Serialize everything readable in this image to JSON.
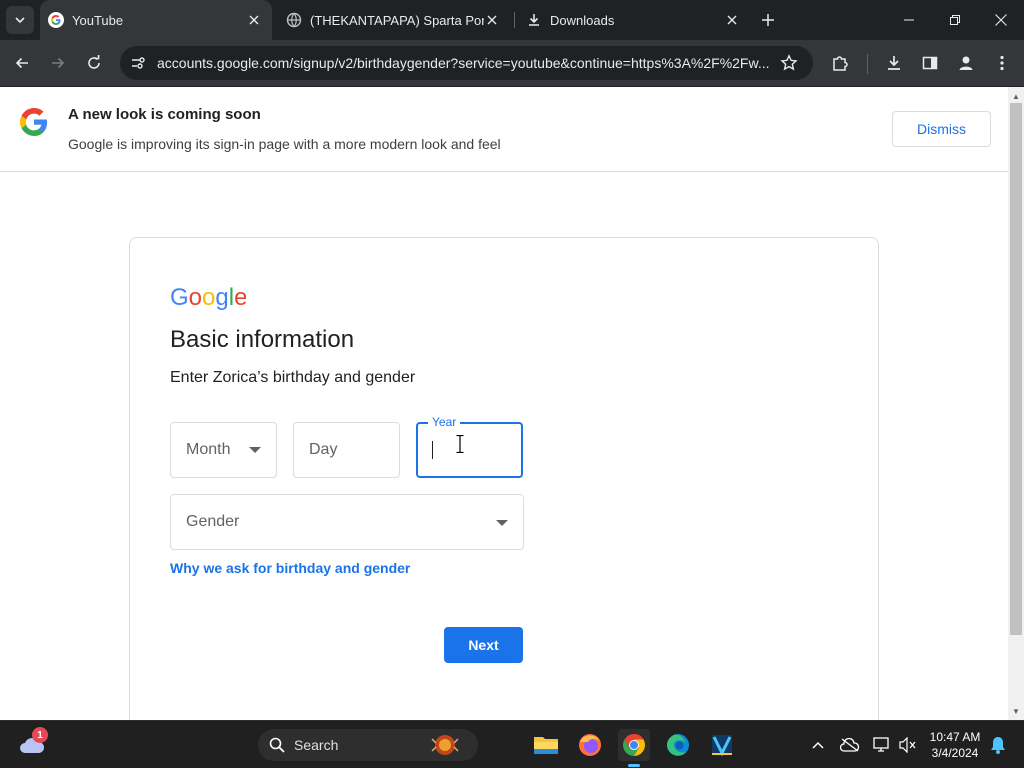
{
  "browser": {
    "tabs": [
      {
        "title": "YouTube",
        "favicon": "google-icon",
        "active": true
      },
      {
        "title": "(THEKANTAPAPA) Sparta Porta",
        "favicon": "globe-icon",
        "active": false
      },
      {
        "title": "Downloads",
        "favicon": "download-icon",
        "active": false
      }
    ],
    "url": "accounts.google.com/signup/v2/birthdaygender?service=youtube&continue=https%3A%2F%2Fw..."
  },
  "banner": {
    "title": "A new look is coming soon",
    "description": "Google is improving its sign-in page with a more modern look and feel",
    "dismiss_label": "Dismiss"
  },
  "card": {
    "wordmark": "Google",
    "heading": "Basic information",
    "subheading": "Enter Zorica’s birthday and gender",
    "month_placeholder": "Month",
    "day_placeholder": "Day",
    "year_label": "Year",
    "gender_placeholder": "Gender",
    "why_link": "Why we ask for birthday and gender",
    "next_label": "Next"
  },
  "taskbar": {
    "weather_badge": "1",
    "search_label": "Search",
    "time": "10:47 AM",
    "date": "3/4/2024"
  },
  "colors": {
    "accent": "#1a73e8",
    "browser_dark": "#202124",
    "browser_toolbar": "#35363a",
    "taskbar": "#202020"
  }
}
